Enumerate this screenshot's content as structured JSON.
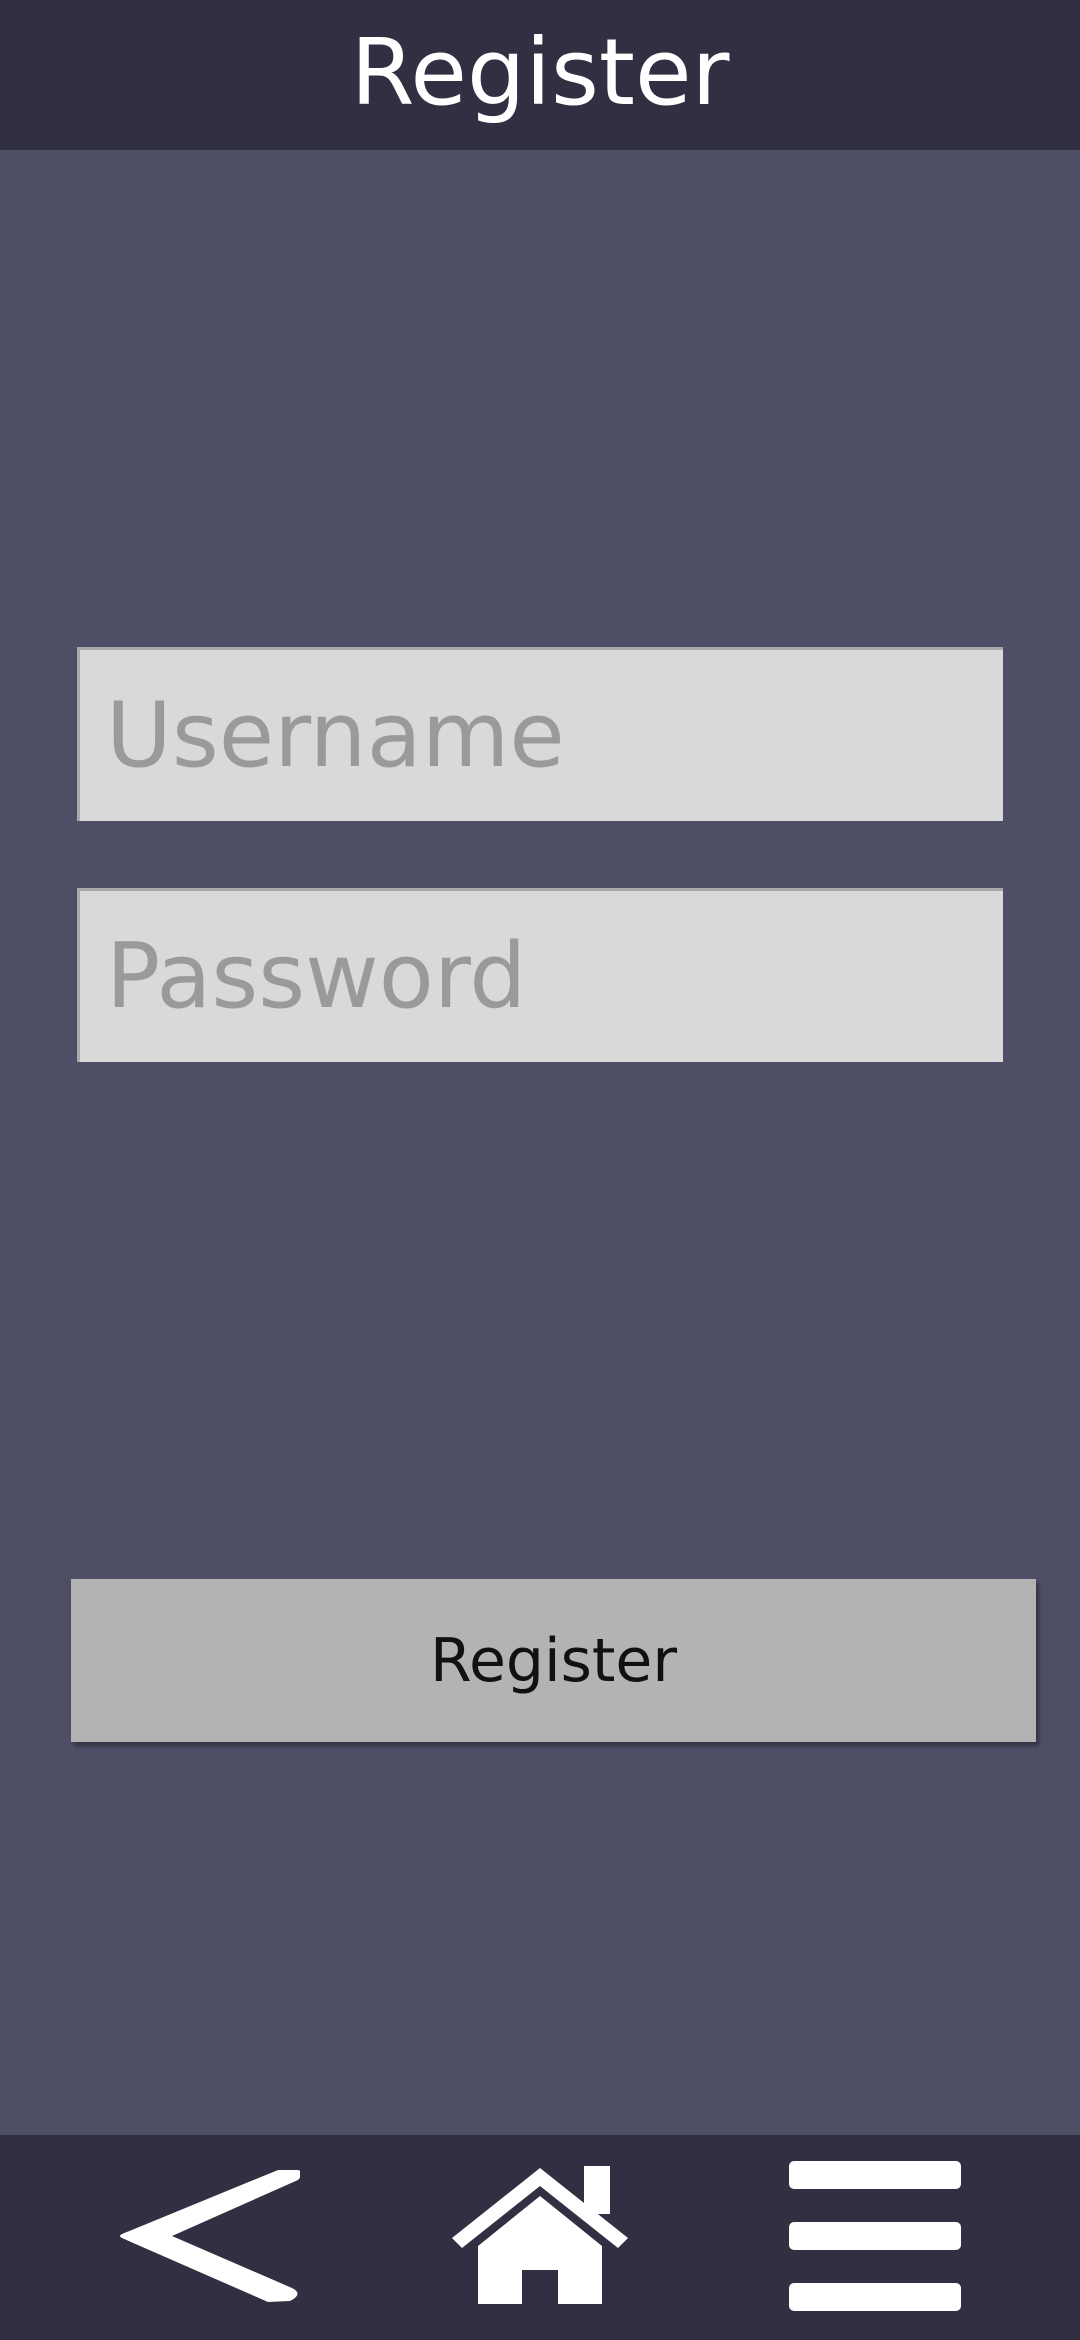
{
  "header": {
    "title": "Register"
  },
  "form": {
    "username_placeholder": "Username",
    "username_value": "",
    "password_placeholder": "Password",
    "password_value": "",
    "register_label": "Register"
  },
  "nav": {
    "items": [
      {
        "icon": "back-icon"
      },
      {
        "icon": "home-icon"
      },
      {
        "icon": "menu-icon"
      }
    ]
  },
  "colors": {
    "background": "#4e4e66",
    "bars": "#303042",
    "field": "#d9d9d9",
    "placeholder": "#9a9a9a",
    "button": "#b3b3b3",
    "icon": "#ffffff"
  }
}
